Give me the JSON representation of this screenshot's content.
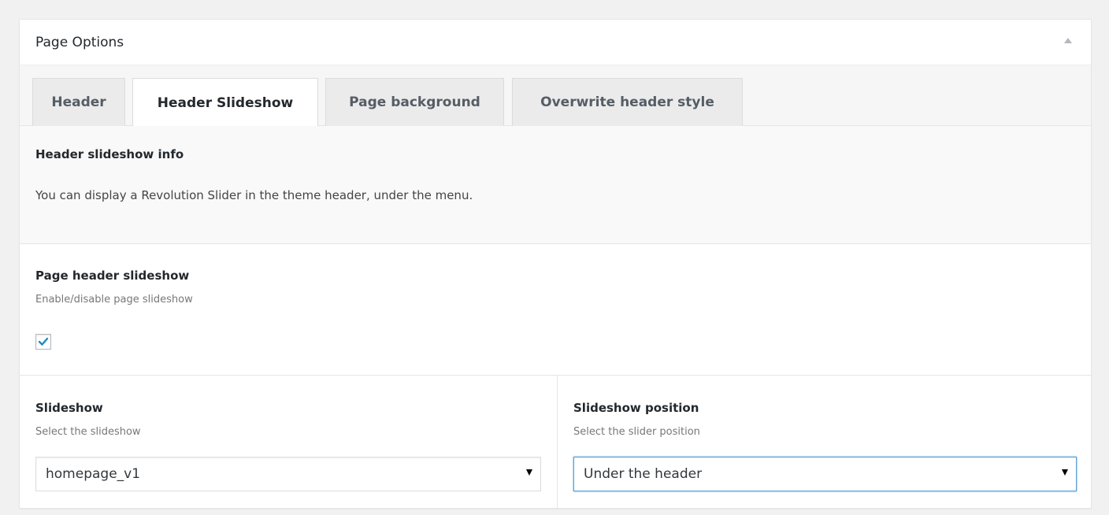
{
  "panel": {
    "title": "Page Options"
  },
  "tabs": [
    {
      "label": "Header"
    },
    {
      "label": "Header Slideshow"
    },
    {
      "label": "Page background"
    },
    {
      "label": "Overwrite header style"
    }
  ],
  "info": {
    "title": "Header slideshow info",
    "text": "You can display a Revolution Slider in the theme header, under the menu."
  },
  "page_header_slideshow": {
    "title": "Page header slideshow",
    "description": "Enable/disable page slideshow",
    "checked": true
  },
  "slideshow": {
    "title": "Slideshow",
    "description": "Select the slideshow",
    "selected": "homepage_v1"
  },
  "slideshow_position": {
    "title": "Slideshow position",
    "description": "Select the slider position",
    "selected": "Under the header"
  },
  "colors": {
    "accent": "#1e8cbe",
    "focus_border": "#5b9dd9"
  },
  "icons": {
    "toggle": "triangle-up-icon",
    "checkbox": "checkmark-icon",
    "select": "caret-down-icon"
  }
}
